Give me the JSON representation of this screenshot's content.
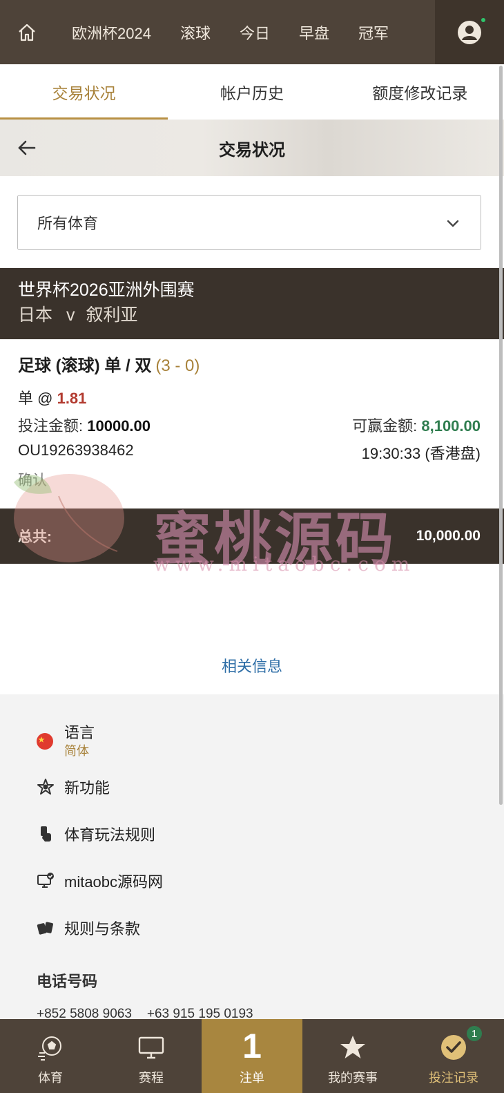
{
  "topnav": {
    "items": [
      "欧洲杯2024",
      "滚球",
      "今日",
      "早盘",
      "冠军"
    ]
  },
  "tabs": [
    "交易状况",
    "帐户历史",
    "额度修改记录"
  ],
  "page": {
    "title": "交易状况"
  },
  "filter": {
    "value": "所有体育"
  },
  "match": {
    "competition": "世界杯2026亚洲外围赛",
    "home": "日本",
    "vs": "v",
    "away": "叙利亚"
  },
  "bet": {
    "market": "足球 (滚球) 单 / 双",
    "score": "(3 - 0)",
    "selection": "单 @",
    "odds": "1.81",
    "stake_label": "投注金额:",
    "stake": "10000.00",
    "win_label": "可赢金额:",
    "win": "8,100.00",
    "ref": "OU19263938462",
    "time": "19:30:33 (香港盘)",
    "status": "确认"
  },
  "total": {
    "label": "总共:",
    "amount": "10,000.00"
  },
  "related_link": "相关信息",
  "watermark": {
    "big": "蜜桃源码",
    "small": "www.mitaobc.com"
  },
  "footer": {
    "language_label": "语言",
    "language_value": "简体",
    "menu": [
      "新功能",
      "体育玩法规则",
      "mitaobc源码网",
      "规则与条款"
    ],
    "phone_heading": "电话号码",
    "phones": [
      "+852 5808 9063",
      "+63 915 195 0193"
    ]
  },
  "bottomnav": {
    "items": [
      "体育",
      "赛程",
      "注单",
      "我的赛事",
      "投注记录"
    ],
    "slip_count": "1",
    "records_badge": "1"
  },
  "colors": {
    "nav_bg": "#4e4339",
    "accent_gold": "#a8823a",
    "odds_red": "#b23a2f",
    "win_green": "#2f7d4f",
    "link_blue": "#2d6da6"
  }
}
